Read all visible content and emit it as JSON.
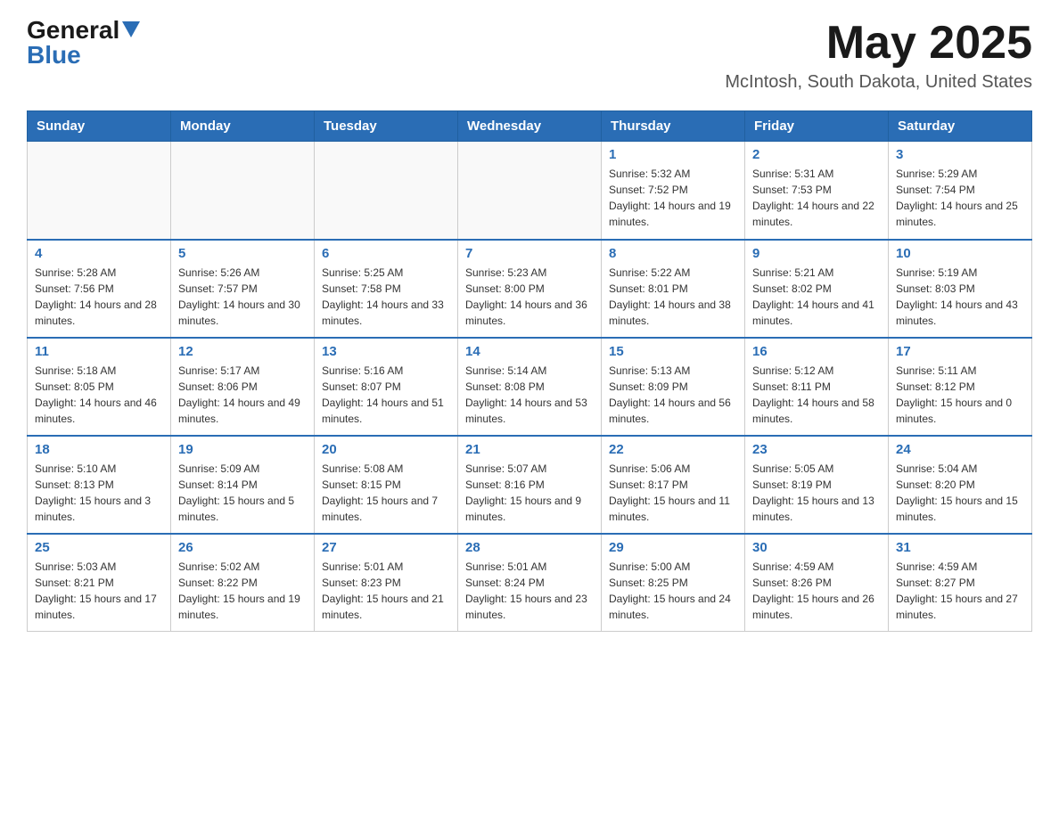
{
  "header": {
    "logo_general": "General",
    "logo_blue": "Blue",
    "month_title": "May 2025",
    "location": "McIntosh, South Dakota, United States"
  },
  "days_of_week": [
    "Sunday",
    "Monday",
    "Tuesday",
    "Wednesday",
    "Thursday",
    "Friday",
    "Saturday"
  ],
  "weeks": [
    [
      {
        "day": "",
        "sunrise": "",
        "sunset": "",
        "daylight": ""
      },
      {
        "day": "",
        "sunrise": "",
        "sunset": "",
        "daylight": ""
      },
      {
        "day": "",
        "sunrise": "",
        "sunset": "",
        "daylight": ""
      },
      {
        "day": "",
        "sunrise": "",
        "sunset": "",
        "daylight": ""
      },
      {
        "day": "1",
        "sunrise": "Sunrise: 5:32 AM",
        "sunset": "Sunset: 7:52 PM",
        "daylight": "Daylight: 14 hours and 19 minutes."
      },
      {
        "day": "2",
        "sunrise": "Sunrise: 5:31 AM",
        "sunset": "Sunset: 7:53 PM",
        "daylight": "Daylight: 14 hours and 22 minutes."
      },
      {
        "day": "3",
        "sunrise": "Sunrise: 5:29 AM",
        "sunset": "Sunset: 7:54 PM",
        "daylight": "Daylight: 14 hours and 25 minutes."
      }
    ],
    [
      {
        "day": "4",
        "sunrise": "Sunrise: 5:28 AM",
        "sunset": "Sunset: 7:56 PM",
        "daylight": "Daylight: 14 hours and 28 minutes."
      },
      {
        "day": "5",
        "sunrise": "Sunrise: 5:26 AM",
        "sunset": "Sunset: 7:57 PM",
        "daylight": "Daylight: 14 hours and 30 minutes."
      },
      {
        "day": "6",
        "sunrise": "Sunrise: 5:25 AM",
        "sunset": "Sunset: 7:58 PM",
        "daylight": "Daylight: 14 hours and 33 minutes."
      },
      {
        "day": "7",
        "sunrise": "Sunrise: 5:23 AM",
        "sunset": "Sunset: 8:00 PM",
        "daylight": "Daylight: 14 hours and 36 minutes."
      },
      {
        "day": "8",
        "sunrise": "Sunrise: 5:22 AM",
        "sunset": "Sunset: 8:01 PM",
        "daylight": "Daylight: 14 hours and 38 minutes."
      },
      {
        "day": "9",
        "sunrise": "Sunrise: 5:21 AM",
        "sunset": "Sunset: 8:02 PM",
        "daylight": "Daylight: 14 hours and 41 minutes."
      },
      {
        "day": "10",
        "sunrise": "Sunrise: 5:19 AM",
        "sunset": "Sunset: 8:03 PM",
        "daylight": "Daylight: 14 hours and 43 minutes."
      }
    ],
    [
      {
        "day": "11",
        "sunrise": "Sunrise: 5:18 AM",
        "sunset": "Sunset: 8:05 PM",
        "daylight": "Daylight: 14 hours and 46 minutes."
      },
      {
        "day": "12",
        "sunrise": "Sunrise: 5:17 AM",
        "sunset": "Sunset: 8:06 PM",
        "daylight": "Daylight: 14 hours and 49 minutes."
      },
      {
        "day": "13",
        "sunrise": "Sunrise: 5:16 AM",
        "sunset": "Sunset: 8:07 PM",
        "daylight": "Daylight: 14 hours and 51 minutes."
      },
      {
        "day": "14",
        "sunrise": "Sunrise: 5:14 AM",
        "sunset": "Sunset: 8:08 PM",
        "daylight": "Daylight: 14 hours and 53 minutes."
      },
      {
        "day": "15",
        "sunrise": "Sunrise: 5:13 AM",
        "sunset": "Sunset: 8:09 PM",
        "daylight": "Daylight: 14 hours and 56 minutes."
      },
      {
        "day": "16",
        "sunrise": "Sunrise: 5:12 AM",
        "sunset": "Sunset: 8:11 PM",
        "daylight": "Daylight: 14 hours and 58 minutes."
      },
      {
        "day": "17",
        "sunrise": "Sunrise: 5:11 AM",
        "sunset": "Sunset: 8:12 PM",
        "daylight": "Daylight: 15 hours and 0 minutes."
      }
    ],
    [
      {
        "day": "18",
        "sunrise": "Sunrise: 5:10 AM",
        "sunset": "Sunset: 8:13 PM",
        "daylight": "Daylight: 15 hours and 3 minutes."
      },
      {
        "day": "19",
        "sunrise": "Sunrise: 5:09 AM",
        "sunset": "Sunset: 8:14 PM",
        "daylight": "Daylight: 15 hours and 5 minutes."
      },
      {
        "day": "20",
        "sunrise": "Sunrise: 5:08 AM",
        "sunset": "Sunset: 8:15 PM",
        "daylight": "Daylight: 15 hours and 7 minutes."
      },
      {
        "day": "21",
        "sunrise": "Sunrise: 5:07 AM",
        "sunset": "Sunset: 8:16 PM",
        "daylight": "Daylight: 15 hours and 9 minutes."
      },
      {
        "day": "22",
        "sunrise": "Sunrise: 5:06 AM",
        "sunset": "Sunset: 8:17 PM",
        "daylight": "Daylight: 15 hours and 11 minutes."
      },
      {
        "day": "23",
        "sunrise": "Sunrise: 5:05 AM",
        "sunset": "Sunset: 8:19 PM",
        "daylight": "Daylight: 15 hours and 13 minutes."
      },
      {
        "day": "24",
        "sunrise": "Sunrise: 5:04 AM",
        "sunset": "Sunset: 8:20 PM",
        "daylight": "Daylight: 15 hours and 15 minutes."
      }
    ],
    [
      {
        "day": "25",
        "sunrise": "Sunrise: 5:03 AM",
        "sunset": "Sunset: 8:21 PM",
        "daylight": "Daylight: 15 hours and 17 minutes."
      },
      {
        "day": "26",
        "sunrise": "Sunrise: 5:02 AM",
        "sunset": "Sunset: 8:22 PM",
        "daylight": "Daylight: 15 hours and 19 minutes."
      },
      {
        "day": "27",
        "sunrise": "Sunrise: 5:01 AM",
        "sunset": "Sunset: 8:23 PM",
        "daylight": "Daylight: 15 hours and 21 minutes."
      },
      {
        "day": "28",
        "sunrise": "Sunrise: 5:01 AM",
        "sunset": "Sunset: 8:24 PM",
        "daylight": "Daylight: 15 hours and 23 minutes."
      },
      {
        "day": "29",
        "sunrise": "Sunrise: 5:00 AM",
        "sunset": "Sunset: 8:25 PM",
        "daylight": "Daylight: 15 hours and 24 minutes."
      },
      {
        "day": "30",
        "sunrise": "Sunrise: 4:59 AM",
        "sunset": "Sunset: 8:26 PM",
        "daylight": "Daylight: 15 hours and 26 minutes."
      },
      {
        "day": "31",
        "sunrise": "Sunrise: 4:59 AM",
        "sunset": "Sunset: 8:27 PM",
        "daylight": "Daylight: 15 hours and 27 minutes."
      }
    ]
  ]
}
